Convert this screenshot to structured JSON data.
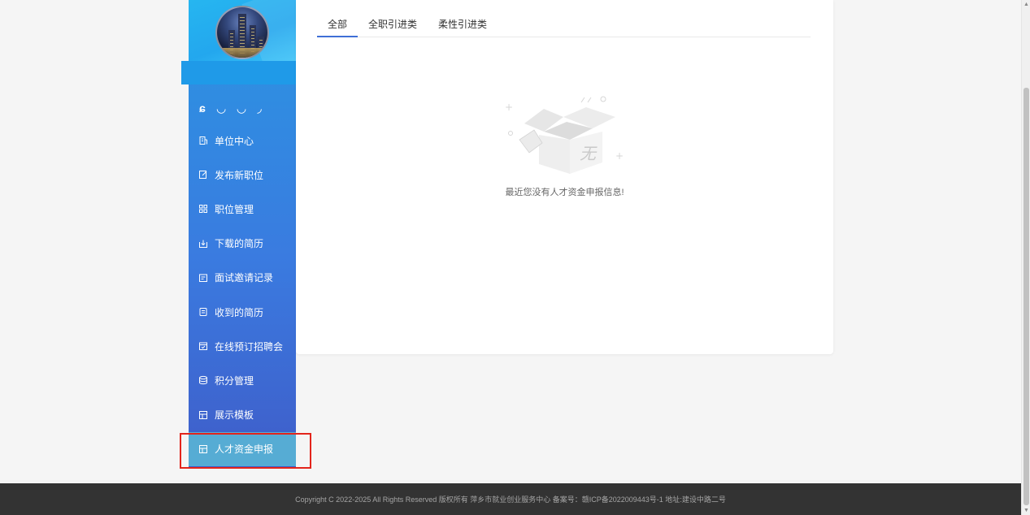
{
  "sidebar": {
    "squiggle_glyphs": [
      "ɕ",
      "◡",
      "◡",
      "◞"
    ],
    "items": [
      {
        "label": "单位中心",
        "icon": "building-icon"
      },
      {
        "label": "发布新职位",
        "icon": "edit-doc-icon"
      },
      {
        "label": "职位管理",
        "icon": "grid-icon"
      },
      {
        "label": "下载的简历",
        "icon": "download-icon"
      },
      {
        "label": "面试邀请记录",
        "icon": "calendar-icon"
      },
      {
        "label": "收到的简历",
        "icon": "document-icon"
      },
      {
        "label": "在线预订招聘会",
        "icon": "calendar-check-icon"
      },
      {
        "label": "积分管理",
        "icon": "database-icon"
      },
      {
        "label": "展示模板",
        "icon": "template-icon"
      },
      {
        "label": "人才资金申报",
        "icon": "template-icon",
        "active": true
      }
    ]
  },
  "tabs": [
    {
      "label": "全部",
      "active": true
    },
    {
      "label": "全职引进类"
    },
    {
      "label": "柔性引进类"
    }
  ],
  "empty": {
    "box_char": "无",
    "message": "最近您没有人才资金申报信息!"
  },
  "footer": {
    "text": "Copyright C 2022-2025 All Rights Reserved 版权所有 萍乡市就业创业服务中心 备案号：赣ICP备2022009443号-1 地址:建设中路二号"
  },
  "colors": {
    "sidebar_top": "#26b6f0",
    "sidebar_bottom": "#3f5dc9",
    "active_item": "#56acd4",
    "tab_underline": "#3f6fd6",
    "highlight": "#e3241b",
    "footer_bg": "#333333"
  }
}
